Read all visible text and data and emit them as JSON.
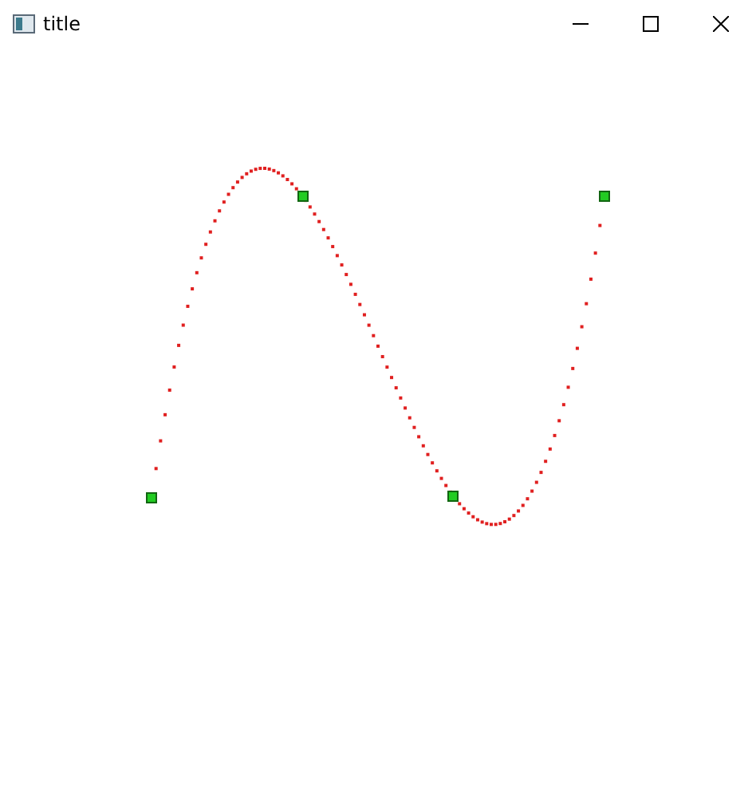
{
  "window": {
    "title": "title"
  }
}
